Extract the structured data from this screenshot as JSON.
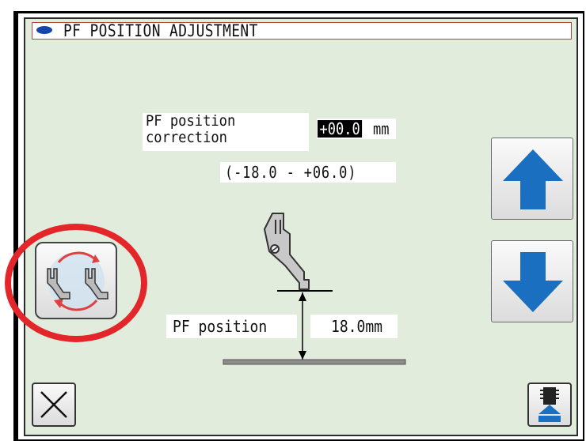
{
  "window": {
    "title": "PF POSITION ADJUSTMENT"
  },
  "correction": {
    "label": "PF position\ncorrection",
    "value": "+00.0",
    "unit": "mm",
    "range": "(-18.0 - +06.0)"
  },
  "pf_position": {
    "label": "PF position",
    "value": "18.0mm"
  },
  "buttons": {
    "up": "arrow-up-icon",
    "down": "arrow-down-icon",
    "pf_toggle": "presser-foot-switch-icon",
    "close": "close-icon",
    "feed": "presser-foot-raise-icon"
  },
  "colors": {
    "screen_bg": "#e1ecdd",
    "arrow_blue": "#1a6fc0",
    "highlight_red": "#e3262a",
    "cycle_red": "#e04040"
  }
}
